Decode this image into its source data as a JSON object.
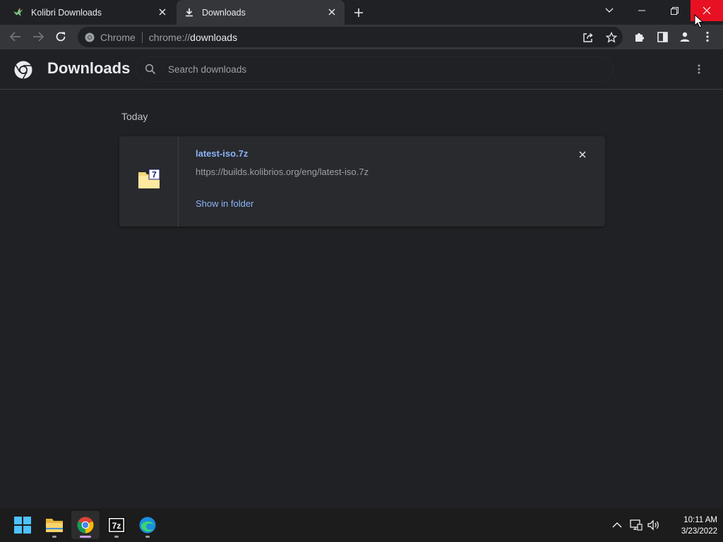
{
  "tabs": [
    {
      "title": "Kolibri Downloads",
      "icon": "kolibri-bird-icon"
    },
    {
      "title": "Downloads",
      "icon": "download-icon",
      "active": true
    }
  ],
  "toolbar": {
    "site_label": "Chrome",
    "url_scheme": "chrome://",
    "url_host": "downloads"
  },
  "header": {
    "title": "Downloads",
    "search_placeholder": "Search downloads"
  },
  "section": {
    "label": "Today"
  },
  "download": {
    "filename": "latest-iso.7z",
    "url": "https://builds.kolibrios.org/eng/latest-iso.7z",
    "action": "Show in folder",
    "file_type_badge": "7"
  },
  "taskbar": {
    "apps": [
      "start-menu",
      "file-explorer",
      "chrome",
      "7-zip",
      "edge"
    ],
    "app_7z_label": "7z",
    "time": "10:11 AM",
    "date": "3/23/2022"
  },
  "colors": {
    "accent_link": "#8ab4f8",
    "close_red": "#e81123",
    "background": "#202124"
  }
}
